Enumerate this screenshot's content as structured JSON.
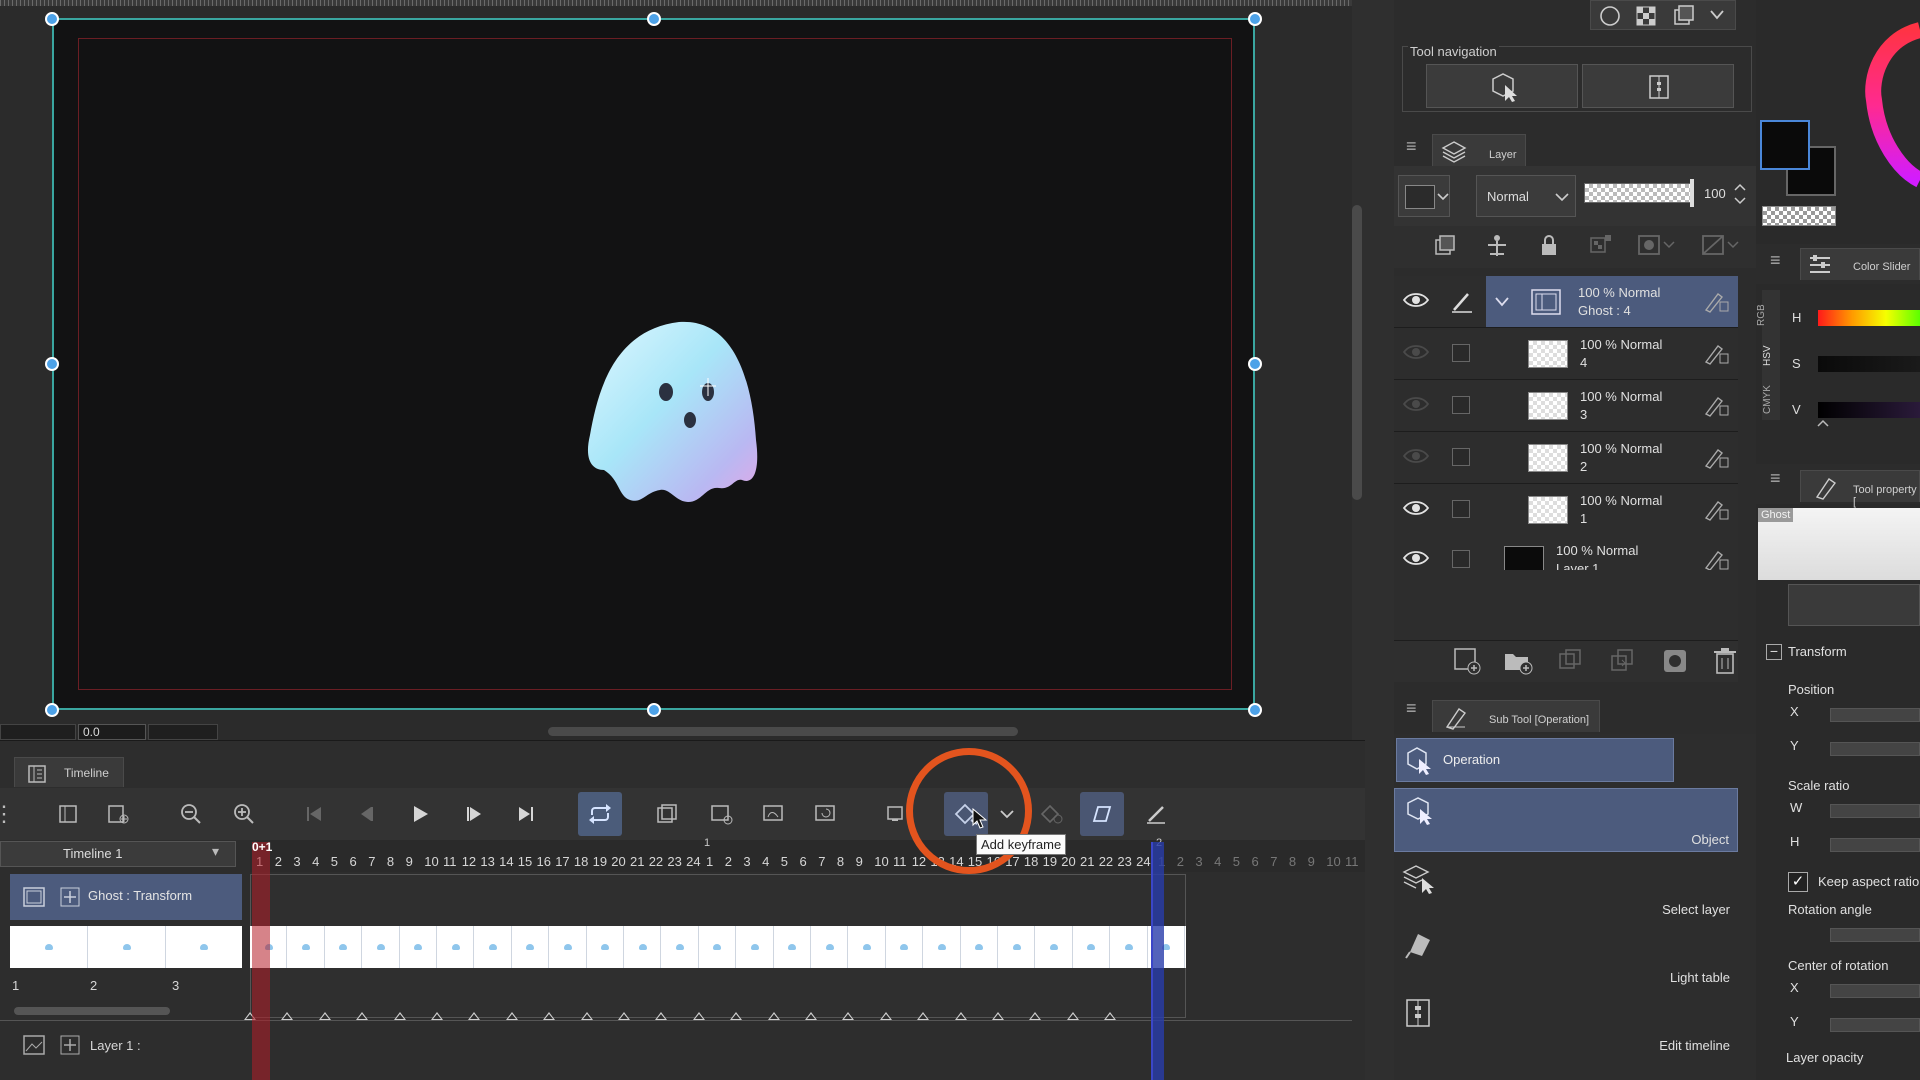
{
  "canvas": {
    "zoom_value": "0.0",
    "tooltip": "Add keyframe"
  },
  "timeline": {
    "tab_label": "Timeline",
    "selector": "Timeline 1",
    "playhead_label": "0+1",
    "cycle_markers": [
      "1",
      "2"
    ],
    "frame_numbers_a": [
      "1",
      "2",
      "3",
      "4",
      "5",
      "6",
      "7",
      "8",
      "9",
      "10",
      "11",
      "12",
      "13",
      "14",
      "15",
      "16",
      "17",
      "18",
      "19",
      "20",
      "21",
      "22",
      "23",
      "24"
    ],
    "frame_numbers_b": [
      "1",
      "2",
      "3",
      "4",
      "5",
      "6",
      "7",
      "8",
      "9",
      "10",
      "11",
      "12",
      "13",
      "14",
      "15",
      "16",
      "17",
      "18",
      "19",
      "20",
      "21",
      "22",
      "23",
      "24"
    ],
    "frame_numbers_c": [
      "1",
      "2",
      "3",
      "4",
      "5",
      "6",
      "7",
      "8",
      "9",
      "10",
      "11"
    ],
    "tracks": [
      {
        "label": "Ghost : Transform"
      },
      {
        "label": "Layer 1 :"
      }
    ],
    "cel_numbers": [
      "1",
      "2",
      "3"
    ]
  },
  "tool_navigation": {
    "label": "Tool navigation"
  },
  "layer_panel": {
    "title": "Layer",
    "blend_mode": "Normal",
    "opacity": "100",
    "layers": [
      {
        "line1": "100 % Normal",
        "line2": "Ghost : 4",
        "selected": true
      },
      {
        "line1": "100 % Normal",
        "line2": "4"
      },
      {
        "line1": "100 % Normal",
        "line2": "3"
      },
      {
        "line1": "100 % Normal",
        "line2": "2"
      },
      {
        "line1": "100 % Normal",
        "line2": "1"
      },
      {
        "line1": "100 % Normal",
        "line2": "Layer 1"
      }
    ]
  },
  "sub_tool": {
    "title": "Sub Tool [Operation]",
    "operation_label": "Operation",
    "items": [
      "Object",
      "Select layer",
      "Light table",
      "Edit timeline"
    ]
  },
  "color_slider": {
    "title": "Color Slider",
    "modes": [
      "RGB",
      "HSV",
      "CMYK"
    ],
    "channels": [
      "H",
      "S",
      "V"
    ]
  },
  "tool_property": {
    "title": "Tool property [",
    "preset_name": "Ghost",
    "section": "Transform",
    "position_label": "Position",
    "x_label": "X",
    "y_label": "Y",
    "scale_label": "Scale ratio",
    "w_label": "W",
    "h_label": "H",
    "keep_aspect_label": "Keep aspect ratio",
    "rotation_label": "Rotation angle",
    "center_label": "Center of rotation",
    "cx_label": "X",
    "cy_label": "Y",
    "layer_opacity_label": "Layer opacity"
  },
  "colors": {
    "accent_selection": "#4c5b7d",
    "handle_blue": "#4da2e8",
    "frame_teal": "#3aa6a0",
    "highlight_orange": "#e3541e",
    "playhead_red": "#b41e28"
  }
}
